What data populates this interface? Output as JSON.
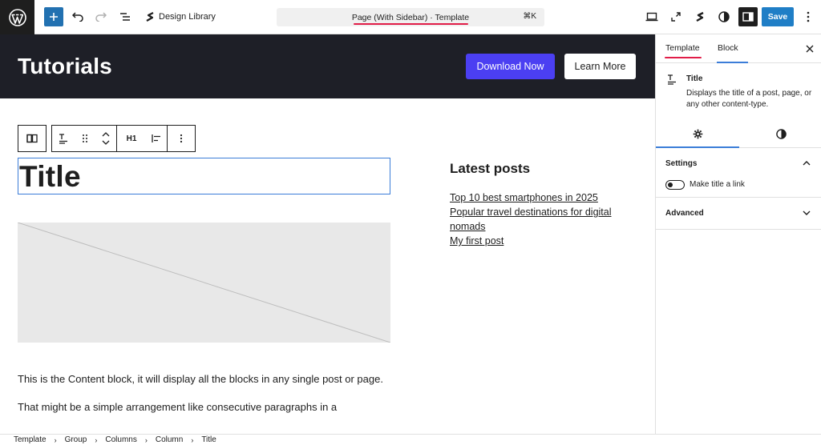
{
  "topbar": {
    "design_library_label": "Design Library",
    "command_bar_label": "Page (With Sidebar) · Template",
    "command_shortcut": "⌘K",
    "save_label": "Save"
  },
  "hero": {
    "title": "Tutorials",
    "download_label": "Download Now",
    "learn_label": "Learn More"
  },
  "block_toolbar": {
    "heading_level": "H1"
  },
  "main": {
    "title_block_text": "Title",
    "content_paragraphs": [
      "This is the Content block, it will display all the blocks in any single post or page.",
      "That might be a simple arrangement like consecutive paragraphs in a"
    ]
  },
  "latest_posts": {
    "title": "Latest posts",
    "items": [
      "Top 10 best smartphones in 2025",
      "Popular travel destinations for digital nomads",
      "My first post"
    ]
  },
  "sidebar": {
    "tabs": [
      {
        "label": "Template"
      },
      {
        "label": "Block"
      }
    ],
    "block_name": "Title",
    "block_description": "Displays the title of a post, page, or any other content-type.",
    "settings_title": "Settings",
    "toggle_label": "Make title a link",
    "advanced_title": "Advanced"
  },
  "breadcrumb": [
    "Template",
    "Group",
    "Columns",
    "Column",
    "Title"
  ],
  "colors": {
    "accent": "#1f7ec6",
    "hero_bg": "#1e1f27",
    "download_btn": "#4b3ff2",
    "highlight": "#e11d48",
    "selection": "#3b7dd8"
  }
}
